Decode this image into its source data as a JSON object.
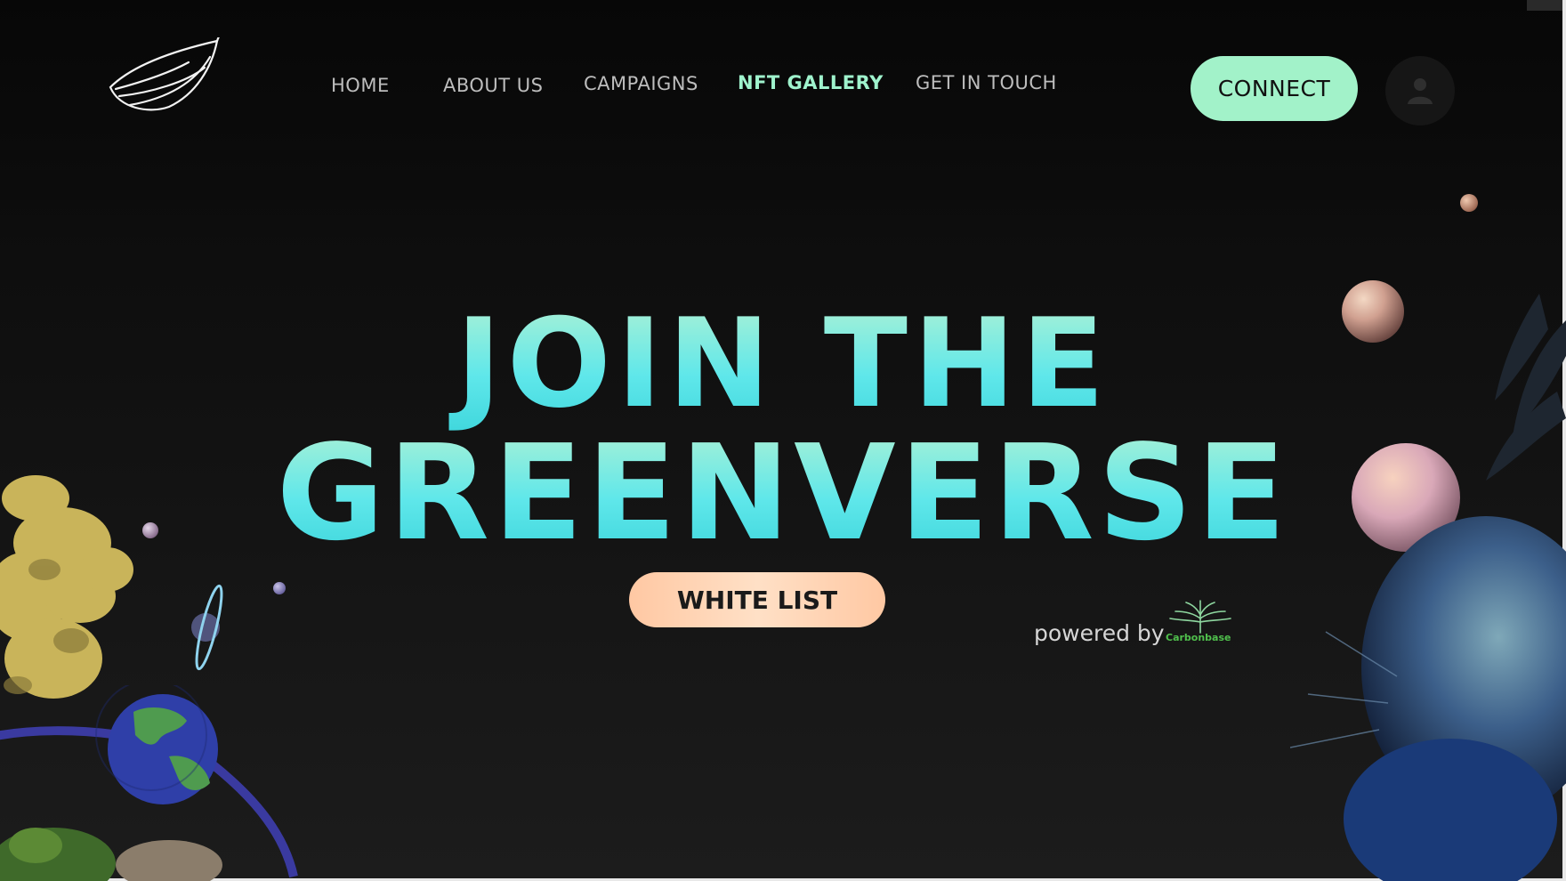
{
  "nav": {
    "items": [
      {
        "label": "HOME",
        "active": false
      },
      {
        "label": "ABOUT US",
        "active": false
      },
      {
        "label": "CAMPAIGNS",
        "active": false
      },
      {
        "label": "NFT GALLERY",
        "active": true
      },
      {
        "label": "GET IN TOUCH",
        "active": false
      }
    ],
    "connect_label": "CONNECT"
  },
  "hero": {
    "line1": "JOIN THE",
    "line2": "GREENVERSE",
    "cta_label": "WHITE LIST"
  },
  "footer": {
    "powered_by": "powered by",
    "partner_name": "Carbonbase"
  },
  "colors": {
    "background": "#0c0c0c",
    "accent_green": "#a2f2c9",
    "title_gradient_top": "#a9f1d6",
    "title_gradient_bottom": "#3ed6dc",
    "cta_peach": "#ffc8a3",
    "nav_text": "#bdbdbd",
    "partner_green": "#4fbf4c"
  },
  "icons": {
    "logo": "leaf-logo-icon",
    "avatar": "user-icon",
    "partner_logo": "tree-icon"
  }
}
